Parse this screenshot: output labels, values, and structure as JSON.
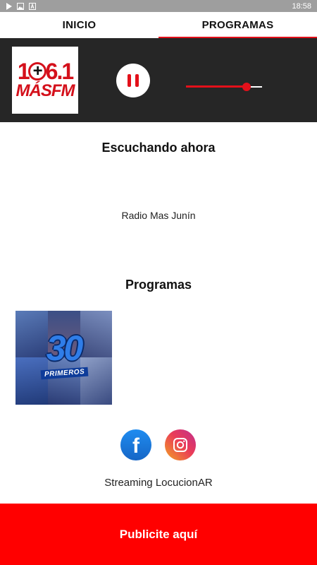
{
  "status_bar": {
    "time": "18:58",
    "icons": [
      "play-icon",
      "image-icon",
      "text-icon"
    ]
  },
  "tabs": [
    {
      "label": "INICIO",
      "active": false
    },
    {
      "label": "PROGRAMAS",
      "active": true
    }
  ],
  "player": {
    "logo": {
      "line1": "106.1",
      "line2": "MÁSFM"
    },
    "state": "playing",
    "control_icon": "pause-icon",
    "volume": 0.8
  },
  "now_playing": {
    "heading": "Escuchando ahora",
    "station": "Radio Mas Junín"
  },
  "programs": {
    "heading": "Programas",
    "items": [
      {
        "number": "30",
        "subtitle": "PRIMEROS"
      }
    ]
  },
  "social": [
    {
      "name": "facebook",
      "icon": "facebook-icon"
    },
    {
      "name": "instagram",
      "icon": "instagram-icon"
    }
  ],
  "footer": {
    "credit": "Streaming LocucionAR"
  },
  "ad_button": {
    "label": "Publicite aquí"
  },
  "colors": {
    "accent": "#e3101a",
    "player_bg": "#262626",
    "ad_bg": "#ff0000"
  }
}
